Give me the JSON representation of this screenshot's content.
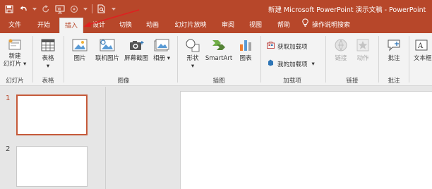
{
  "titlebar": {
    "doc_title": "新建 Microsoft PowerPoint 演示文稿",
    "separator": "-",
    "app_name": "PowerPoint",
    "qat_icons": [
      "save-icon",
      "undo-icon",
      "redo-icon",
      "present-icon",
      "touch-mode-icon",
      "print-preview-icon",
      "customize-qat-icon"
    ]
  },
  "tabs": [
    {
      "label": "文件"
    },
    {
      "label": "开始"
    },
    {
      "label": "插入",
      "active": true
    },
    {
      "label": "设计"
    },
    {
      "label": "切换"
    },
    {
      "label": "动画"
    },
    {
      "label": "幻灯片放映"
    },
    {
      "label": "审阅"
    },
    {
      "label": "视图"
    },
    {
      "label": "帮助"
    },
    {
      "label": "操作说明搜索",
      "icon": "lightbulb-icon"
    }
  ],
  "ribbon": {
    "new_slide": {
      "line1": "新建",
      "line2": "幻灯片"
    },
    "table": "表格",
    "images": {
      "pictures": "图片",
      "online_pictures": "联机图片",
      "screenshot": "屏幕截图",
      "album": "相册"
    },
    "shapes": "形状",
    "smartart": "SmartArt",
    "chart": "图表",
    "addins": {
      "get": "获取加载项",
      "mine": "我的加载项"
    },
    "links": {
      "link": "链接",
      "action": "动作"
    },
    "comment": "批注",
    "textbox": "文本框",
    "groups": {
      "slides": "幻灯片",
      "tables": "表格",
      "images": "图像",
      "illustrations": "插图",
      "addins": "加载项",
      "links": "链接",
      "comments": "批注"
    }
  },
  "slides": [
    {
      "number": "1",
      "selected": true
    },
    {
      "number": "2",
      "selected": false
    }
  ],
  "colors": {
    "accent": "#b7472a",
    "ribbon_bg": "#f3f3f3",
    "workspace_bg": "#e6e6e6",
    "annotation": "#e02020"
  }
}
